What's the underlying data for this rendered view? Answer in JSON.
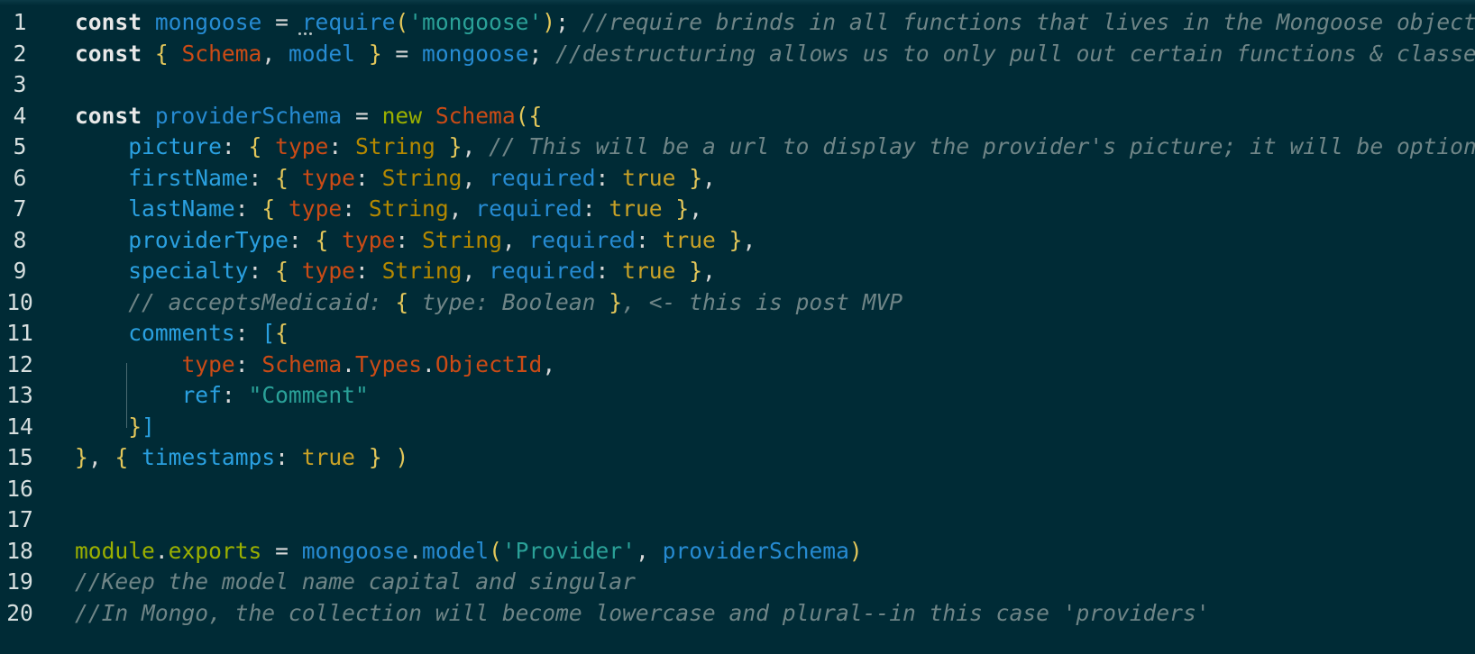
{
  "editor": {
    "lines": [
      {
        "n": "1",
        "tokens": [
          [
            "kw",
            "const"
          ],
          [
            "sp",
            " "
          ],
          [
            "var",
            "mongoose"
          ],
          [
            "op",
            " = "
          ],
          [
            "fn",
            "require"
          ],
          [
            "paren",
            "("
          ],
          [
            "str",
            "'mongoose'"
          ],
          [
            "paren",
            ")"
          ],
          [
            "op",
            "; "
          ],
          [
            "cm",
            "//require brinds in all functions that lives in the Mongoose object"
          ]
        ]
      },
      {
        "n": "2",
        "tokens": [
          [
            "kw",
            "const"
          ],
          [
            "sp",
            " "
          ],
          [
            "brace",
            "{"
          ],
          [
            "sp",
            " "
          ],
          [
            "cls",
            "Schema"
          ],
          [
            "op",
            ", "
          ],
          [
            "var",
            "model"
          ],
          [
            "sp",
            " "
          ],
          [
            "brace",
            "}"
          ],
          [
            "op",
            " = "
          ],
          [
            "var",
            "mongoose"
          ],
          [
            "op",
            "; "
          ],
          [
            "cm",
            "//destructuring allows us to only pull out certain functions & classes t"
          ]
        ]
      },
      {
        "n": "3",
        "tokens": []
      },
      {
        "n": "4",
        "tokens": [
          [
            "kw",
            "const"
          ],
          [
            "sp",
            " "
          ],
          [
            "var",
            "providerSchema"
          ],
          [
            "op",
            " = "
          ],
          [
            "new",
            "new"
          ],
          [
            "sp",
            " "
          ],
          [
            "cls",
            "Schema"
          ],
          [
            "paren",
            "("
          ],
          [
            "brace",
            "{"
          ]
        ]
      },
      {
        "n": "5",
        "tokens": [
          [
            "sp",
            "    "
          ],
          [
            "prop",
            "picture"
          ],
          [
            "op",
            ": "
          ],
          [
            "brace",
            "{"
          ],
          [
            "sp",
            " "
          ],
          [
            "cls",
            "type"
          ],
          [
            "op",
            ": "
          ],
          [
            "type",
            "String"
          ],
          [
            "sp",
            " "
          ],
          [
            "brace",
            "}"
          ],
          [
            "op",
            ", "
          ],
          [
            "cm",
            "// This will be a url to display the provider's picture; it will be optional"
          ]
        ]
      },
      {
        "n": "6",
        "tokens": [
          [
            "sp",
            "    "
          ],
          [
            "prop",
            "firstName"
          ],
          [
            "op",
            ": "
          ],
          [
            "brace",
            "{"
          ],
          [
            "sp",
            " "
          ],
          [
            "cls",
            "type"
          ],
          [
            "op",
            ": "
          ],
          [
            "type",
            "String"
          ],
          [
            "op",
            ", "
          ],
          [
            "key",
            "required"
          ],
          [
            "op",
            ": "
          ],
          [
            "bool",
            "true"
          ],
          [
            "sp",
            " "
          ],
          [
            "brace",
            "}"
          ],
          [
            "op",
            ","
          ]
        ]
      },
      {
        "n": "7",
        "tokens": [
          [
            "sp",
            "    "
          ],
          [
            "prop",
            "lastName"
          ],
          [
            "op",
            ": "
          ],
          [
            "brace",
            "{"
          ],
          [
            "sp",
            " "
          ],
          [
            "cls",
            "type"
          ],
          [
            "op",
            ": "
          ],
          [
            "type",
            "String"
          ],
          [
            "op",
            ", "
          ],
          [
            "key",
            "required"
          ],
          [
            "op",
            ": "
          ],
          [
            "bool",
            "true"
          ],
          [
            "sp",
            " "
          ],
          [
            "brace",
            "}"
          ],
          [
            "op",
            ","
          ]
        ]
      },
      {
        "n": "8",
        "tokens": [
          [
            "sp",
            "    "
          ],
          [
            "prop",
            "providerType"
          ],
          [
            "op",
            ": "
          ],
          [
            "brace",
            "{"
          ],
          [
            "sp",
            " "
          ],
          [
            "cls",
            "type"
          ],
          [
            "op",
            ": "
          ],
          [
            "type",
            "String"
          ],
          [
            "op",
            ", "
          ],
          [
            "key",
            "required"
          ],
          [
            "op",
            ": "
          ],
          [
            "bool",
            "true"
          ],
          [
            "sp",
            " "
          ],
          [
            "brace",
            "}"
          ],
          [
            "op",
            ","
          ]
        ]
      },
      {
        "n": "9",
        "tokens": [
          [
            "sp",
            "    "
          ],
          [
            "prop",
            "specialty"
          ],
          [
            "op",
            ": "
          ],
          [
            "brace",
            "{"
          ],
          [
            "sp",
            " "
          ],
          [
            "cls",
            "type"
          ],
          [
            "op",
            ": "
          ],
          [
            "type",
            "String"
          ],
          [
            "op",
            ", "
          ],
          [
            "key",
            "required"
          ],
          [
            "op",
            ": "
          ],
          [
            "bool",
            "true"
          ],
          [
            "sp",
            " "
          ],
          [
            "brace",
            "}"
          ],
          [
            "op",
            ","
          ]
        ]
      },
      {
        "n": "10",
        "tokens": [
          [
            "sp",
            "    "
          ],
          [
            "cm",
            "// acceptsMedicaid: "
          ],
          [
            "brace",
            "{"
          ],
          [
            "cm",
            " type: Boolean "
          ],
          [
            "brace",
            "}"
          ],
          [
            "cm",
            ", <- this is post MVP"
          ]
        ]
      },
      {
        "n": "11",
        "tokens": [
          [
            "sp",
            "    "
          ],
          [
            "prop",
            "comments"
          ],
          [
            "op",
            ": "
          ],
          [
            "bracket",
            "["
          ],
          [
            "brace",
            "{"
          ]
        ]
      },
      {
        "n": "12",
        "tokens": [
          [
            "sp",
            "        "
          ],
          [
            "cls",
            "type"
          ],
          [
            "op",
            ": "
          ],
          [
            "cls",
            "Schema"
          ],
          [
            "op",
            "."
          ],
          [
            "cls",
            "Types"
          ],
          [
            "op",
            "."
          ],
          [
            "cls",
            "ObjectId"
          ],
          [
            "op",
            ","
          ]
        ]
      },
      {
        "n": "13",
        "tokens": [
          [
            "sp",
            "        "
          ],
          [
            "prop",
            "ref"
          ],
          [
            "op",
            ": "
          ],
          [
            "str",
            "\"Comment\""
          ]
        ]
      },
      {
        "n": "14",
        "tokens": [
          [
            "sp",
            "    "
          ],
          [
            "brace",
            "}"
          ],
          [
            "bracket",
            "]"
          ]
        ]
      },
      {
        "n": "15",
        "tokens": [
          [
            "brace",
            "}"
          ],
          [
            "op",
            ", "
          ],
          [
            "brace",
            "{"
          ],
          [
            "sp",
            " "
          ],
          [
            "prop",
            "timestamps"
          ],
          [
            "op",
            ": "
          ],
          [
            "bool",
            "true"
          ],
          [
            "sp",
            " "
          ],
          [
            "brace",
            "}"
          ],
          [
            "sp",
            " "
          ],
          [
            "paren",
            ")"
          ]
        ]
      },
      {
        "n": "16",
        "tokens": []
      },
      {
        "n": "17",
        "tokens": []
      },
      {
        "n": "18",
        "tokens": [
          [
            "mod",
            "module"
          ],
          [
            "op",
            "."
          ],
          [
            "mod",
            "exports"
          ],
          [
            "op",
            " = "
          ],
          [
            "var",
            "mongoose"
          ],
          [
            "op",
            "."
          ],
          [
            "fn",
            "model"
          ],
          [
            "paren",
            "("
          ],
          [
            "str",
            "'Provider'"
          ],
          [
            "op",
            ", "
          ],
          [
            "var",
            "providerSchema"
          ],
          [
            "paren",
            ")"
          ]
        ]
      },
      {
        "n": "19",
        "tokens": [
          [
            "cm",
            "//Keep the model name capital and singular"
          ]
        ]
      },
      {
        "n": "20",
        "tokens": [
          [
            "cm",
            "//In Mongo, the collection will become lowercase and plural--in this case 'providers'"
          ]
        ]
      }
    ]
  },
  "colors": {
    "background": "#002b36",
    "comment": "#6f8587",
    "string": "#2aa198",
    "keyword": "#e8e8e8",
    "identifier": "#268bd2",
    "class": "#cb4b16",
    "type": "#b58900"
  }
}
